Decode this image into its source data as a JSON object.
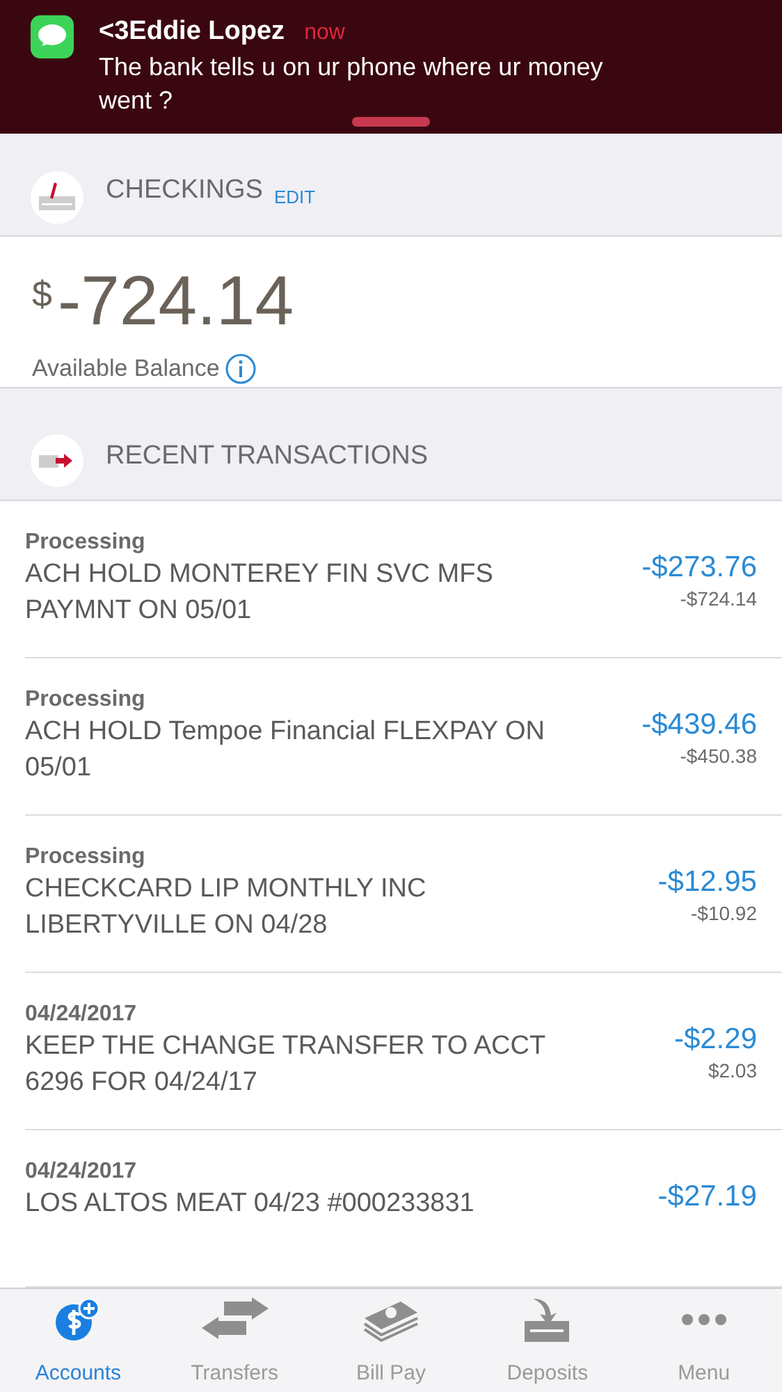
{
  "notification": {
    "sender": "<3Eddie Lopez",
    "time": "now",
    "message": "The bank tells u on ur phone where ur money went ?"
  },
  "account": {
    "title": "CHECKINGS",
    "edit": "EDIT",
    "currency": "$",
    "balance": "-724.14",
    "balance_label": "Available Balance"
  },
  "transactions": {
    "title": "RECENT TRANSACTIONS",
    "rows": [
      {
        "status": "Processing",
        "description": "ACH HOLD MONTEREY FIN SVC MFS PAYMNT ON 05/01",
        "amount": "-$273.76",
        "balance": "-$724.14"
      },
      {
        "status": "Processing",
        "description": "ACH HOLD Tempoe Financial FLEXPAY ON 05/01",
        "amount": "-$439.46",
        "balance": "-$450.38"
      },
      {
        "status": "Processing",
        "description": "CHECKCARD LIP MONTHLY INC LIBERTYVILLE ON 04/28",
        "amount": "-$12.95",
        "balance": "-$10.92"
      },
      {
        "status": "04/24/2017",
        "description": "KEEP THE CHANGE TRANSFER TO ACCT 6296 FOR 04/24/17",
        "amount": "-$2.29",
        "balance": "$2.03"
      },
      {
        "status": "04/24/2017",
        "description": "LOS ALTOS MEAT 04/23 #000233831",
        "amount": "-$27.19"
      }
    ]
  },
  "tab_bar": [
    {
      "kind": "accounts",
      "label": "Accounts",
      "selected": true
    },
    {
      "kind": "transfers",
      "label": "Transfers",
      "selected": false
    },
    {
      "kind": "billpay",
      "label": "Bill Pay",
      "selected": false
    },
    {
      "kind": "deposits",
      "label": "Deposits",
      "selected": false
    },
    {
      "kind": "menu",
      "label": "Menu",
      "selected": false
    }
  ]
}
